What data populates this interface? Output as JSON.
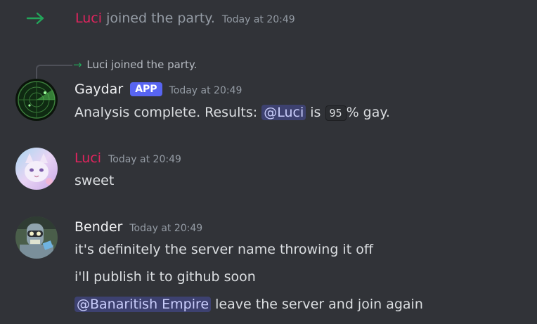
{
  "join": {
    "user": "Luci",
    "text": "joined the party.",
    "timestamp": "Today at 20:49"
  },
  "reply_ref": {
    "text": "Luci joined the party."
  },
  "gaydar": {
    "author": "Gaydar",
    "tag": "APP",
    "timestamp": "Today at 20:49",
    "text_before": "Analysis complete. Results:",
    "mention": "@Luci",
    "text_mid": "is",
    "value": "95",
    "text_after": "% gay."
  },
  "luci": {
    "author": "Luci",
    "timestamp": "Today at 20:49",
    "text": "sweet"
  },
  "bender": {
    "author": "Bender",
    "timestamp": "Today at 20:49",
    "line1": "it's definitely the server name throwing it off",
    "line2": "i'll publish it to github soon",
    "mention": "@Banaritish Empire",
    "line3_rest": "leave the server and join again"
  },
  "colors": {
    "background": "#313338",
    "luci_name": "#e0245e",
    "join_arrow": "#23a55a",
    "app_tag": "#5865f2"
  },
  "icons": {
    "join": "green-right-arrow-icon",
    "gaydar_avatar": "radar-avatar",
    "luci_avatar": "fox-avatar",
    "bender_avatar": "robot-avatar"
  }
}
